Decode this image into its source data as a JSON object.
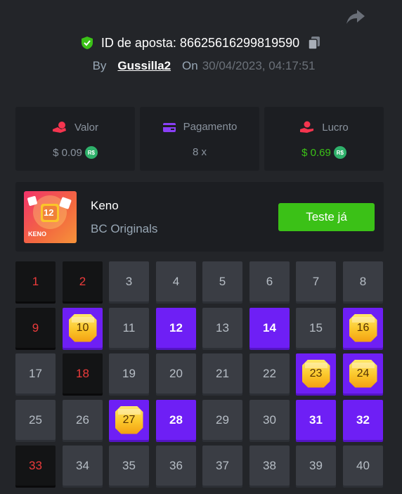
{
  "header": {
    "bet_id_label": "ID de aposta: 86625616299819590",
    "by_label": "By",
    "username": "Gussilla2",
    "on_label": "On",
    "datetime": "30/04/2023, 04:17:51"
  },
  "stats": {
    "valor": {
      "label": "Valor",
      "value": "$ 0.09",
      "coin": "R$"
    },
    "pagamento": {
      "label": "Pagamento",
      "value": "8 x"
    },
    "lucro": {
      "label": "Lucro",
      "value": "$ 0.69",
      "coin": "R$"
    }
  },
  "game": {
    "name": "Keno",
    "provider": "BC Originals",
    "play_button": "Teste já",
    "thumb_number": "12",
    "thumb_text": "KENO"
  },
  "board": {
    "cells": [
      {
        "n": "1",
        "state": "miss"
      },
      {
        "n": "2",
        "state": "miss"
      },
      {
        "n": "3",
        "state": "normal"
      },
      {
        "n": "4",
        "state": "normal"
      },
      {
        "n": "5",
        "state": "normal"
      },
      {
        "n": "6",
        "state": "normal"
      },
      {
        "n": "7",
        "state": "normal"
      },
      {
        "n": "8",
        "state": "normal"
      },
      {
        "n": "9",
        "state": "miss"
      },
      {
        "n": "10",
        "state": "hit"
      },
      {
        "n": "11",
        "state": "normal"
      },
      {
        "n": "12",
        "state": "pick"
      },
      {
        "n": "13",
        "state": "normal"
      },
      {
        "n": "14",
        "state": "pick"
      },
      {
        "n": "15",
        "state": "normal"
      },
      {
        "n": "16",
        "state": "hit"
      },
      {
        "n": "17",
        "state": "normal"
      },
      {
        "n": "18",
        "state": "miss"
      },
      {
        "n": "19",
        "state": "normal"
      },
      {
        "n": "20",
        "state": "normal"
      },
      {
        "n": "21",
        "state": "normal"
      },
      {
        "n": "22",
        "state": "normal"
      },
      {
        "n": "23",
        "state": "hit"
      },
      {
        "n": "24",
        "state": "hit"
      },
      {
        "n": "25",
        "state": "normal"
      },
      {
        "n": "26",
        "state": "normal"
      },
      {
        "n": "27",
        "state": "hit"
      },
      {
        "n": "28",
        "state": "pick"
      },
      {
        "n": "29",
        "state": "normal"
      },
      {
        "n": "30",
        "state": "normal"
      },
      {
        "n": "31",
        "state": "pick"
      },
      {
        "n": "32",
        "state": "pick"
      },
      {
        "n": "33",
        "state": "miss"
      },
      {
        "n": "34",
        "state": "normal"
      },
      {
        "n": "35",
        "state": "normal"
      },
      {
        "n": "36",
        "state": "normal"
      },
      {
        "n": "37",
        "state": "normal"
      },
      {
        "n": "38",
        "state": "normal"
      },
      {
        "n": "39",
        "state": "normal"
      },
      {
        "n": "40",
        "state": "normal"
      }
    ]
  },
  "colors": {
    "accent": "#6e1ff5",
    "green": "#3bc117",
    "miss": "#ed3b3b",
    "background": "#232529"
  },
  "icons": [
    "share-icon",
    "shield-check-icon",
    "copy-icon",
    "bet-amount-icon",
    "wallet-icon",
    "profit-hand-icon",
    "gem-icon"
  ]
}
